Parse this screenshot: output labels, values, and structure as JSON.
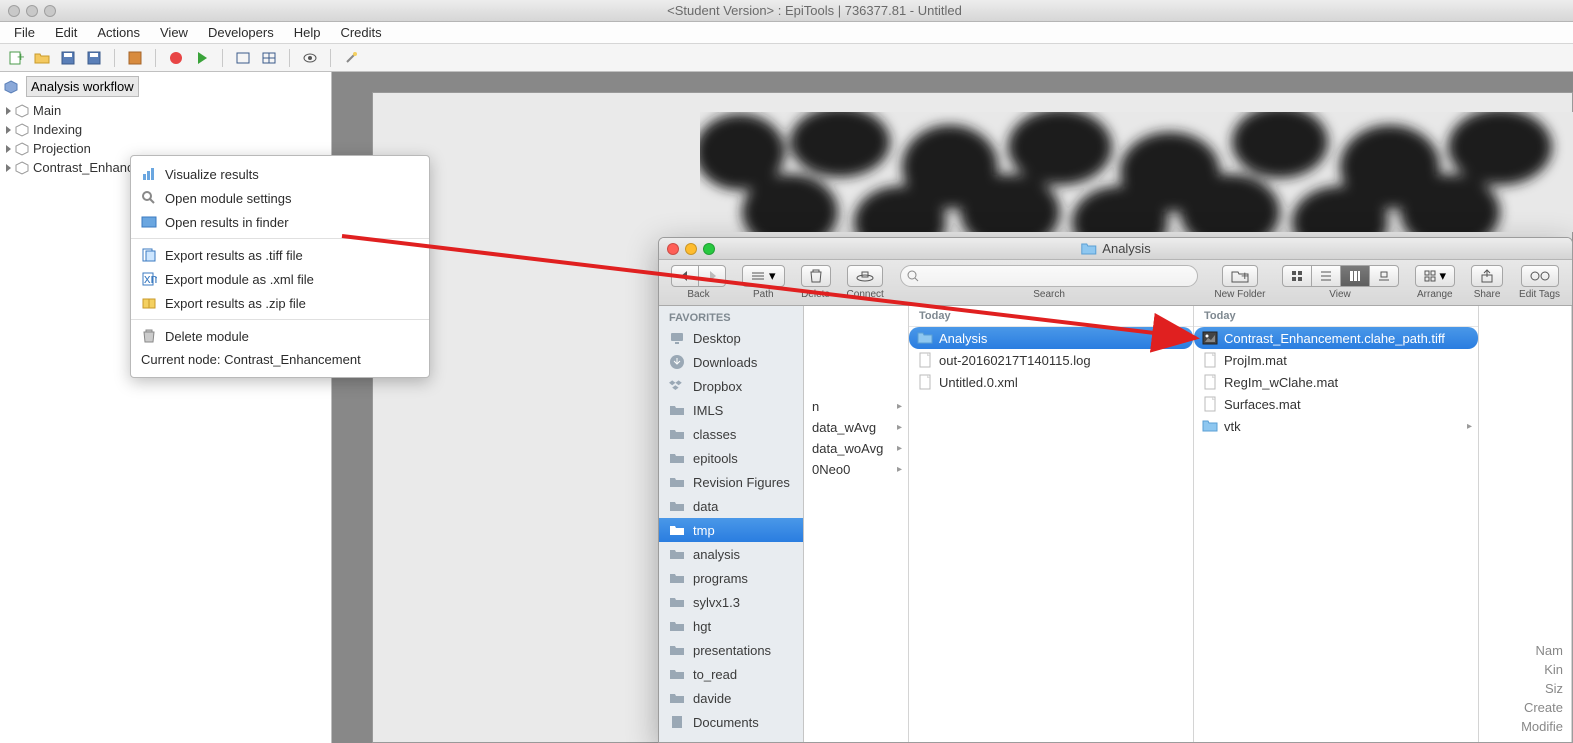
{
  "main": {
    "title": "<Student Version> : EpiTools | 736377.81 - Untitled",
    "menus": [
      "File",
      "Edit",
      "Actions",
      "View",
      "Developers",
      "Help",
      "Credits"
    ],
    "tree_header": "Analysis workflow",
    "tree_items": [
      "Main",
      "Indexing",
      "Projection",
      "Contrast_Enhancement"
    ]
  },
  "context_menu": {
    "items_a": [
      "Visualize results",
      "Open module settings",
      "Open results in finder"
    ],
    "items_b": [
      "Export results as .tiff file",
      "Export module as .xml file",
      "Export results as .zip file"
    ],
    "items_c": [
      "Delete module"
    ],
    "current": "Current node: Contrast_Enhancement"
  },
  "finder": {
    "title": "Analysis",
    "toolbar": {
      "back": "Back",
      "path": "Path",
      "delete": "Delete",
      "connect": "Connect",
      "search": "Search",
      "newfolder": "New Folder",
      "view": "View",
      "arrange": "Arrange",
      "share": "Share",
      "edittags": "Edit Tags",
      "search_placeholder": ""
    },
    "favorites_label": "FAVORITES",
    "favorites": [
      "Desktop",
      "Downloads",
      "Dropbox",
      "IMLS",
      "classes",
      "epitools",
      "Revision Figures",
      "data",
      "tmp",
      "analysis",
      "programs",
      "sylvx1.3",
      "hgt",
      "presentations",
      "to_read",
      "davide",
      "Documents"
    ],
    "favorites_selected": "tmp",
    "col1_partial": [
      "n",
      "data_wAvg",
      "data_woAvg",
      "0Neo0"
    ],
    "col2_header": "Today",
    "col2_items": [
      {
        "name": "Analysis",
        "type": "folder",
        "arrow": true,
        "selected": true
      },
      {
        "name": "out-20160217T140115.log",
        "type": "file"
      },
      {
        "name": "Untitled.0.xml",
        "type": "file"
      }
    ],
    "col3_header": "Today",
    "col3_items": [
      {
        "name": "Contrast_Enhancement.clahe_path.tiff",
        "type": "image",
        "selected": true
      },
      {
        "name": "ProjIm.mat",
        "type": "file"
      },
      {
        "name": "RegIm_wClahe.mat",
        "type": "file"
      },
      {
        "name": "Surfaces.mat",
        "type": "file"
      },
      {
        "name": "vtk",
        "type": "folder",
        "arrow": true
      }
    ],
    "info_labels": [
      "Nam",
      "Kin",
      "Siz",
      "Create",
      "Modifie"
    ]
  }
}
